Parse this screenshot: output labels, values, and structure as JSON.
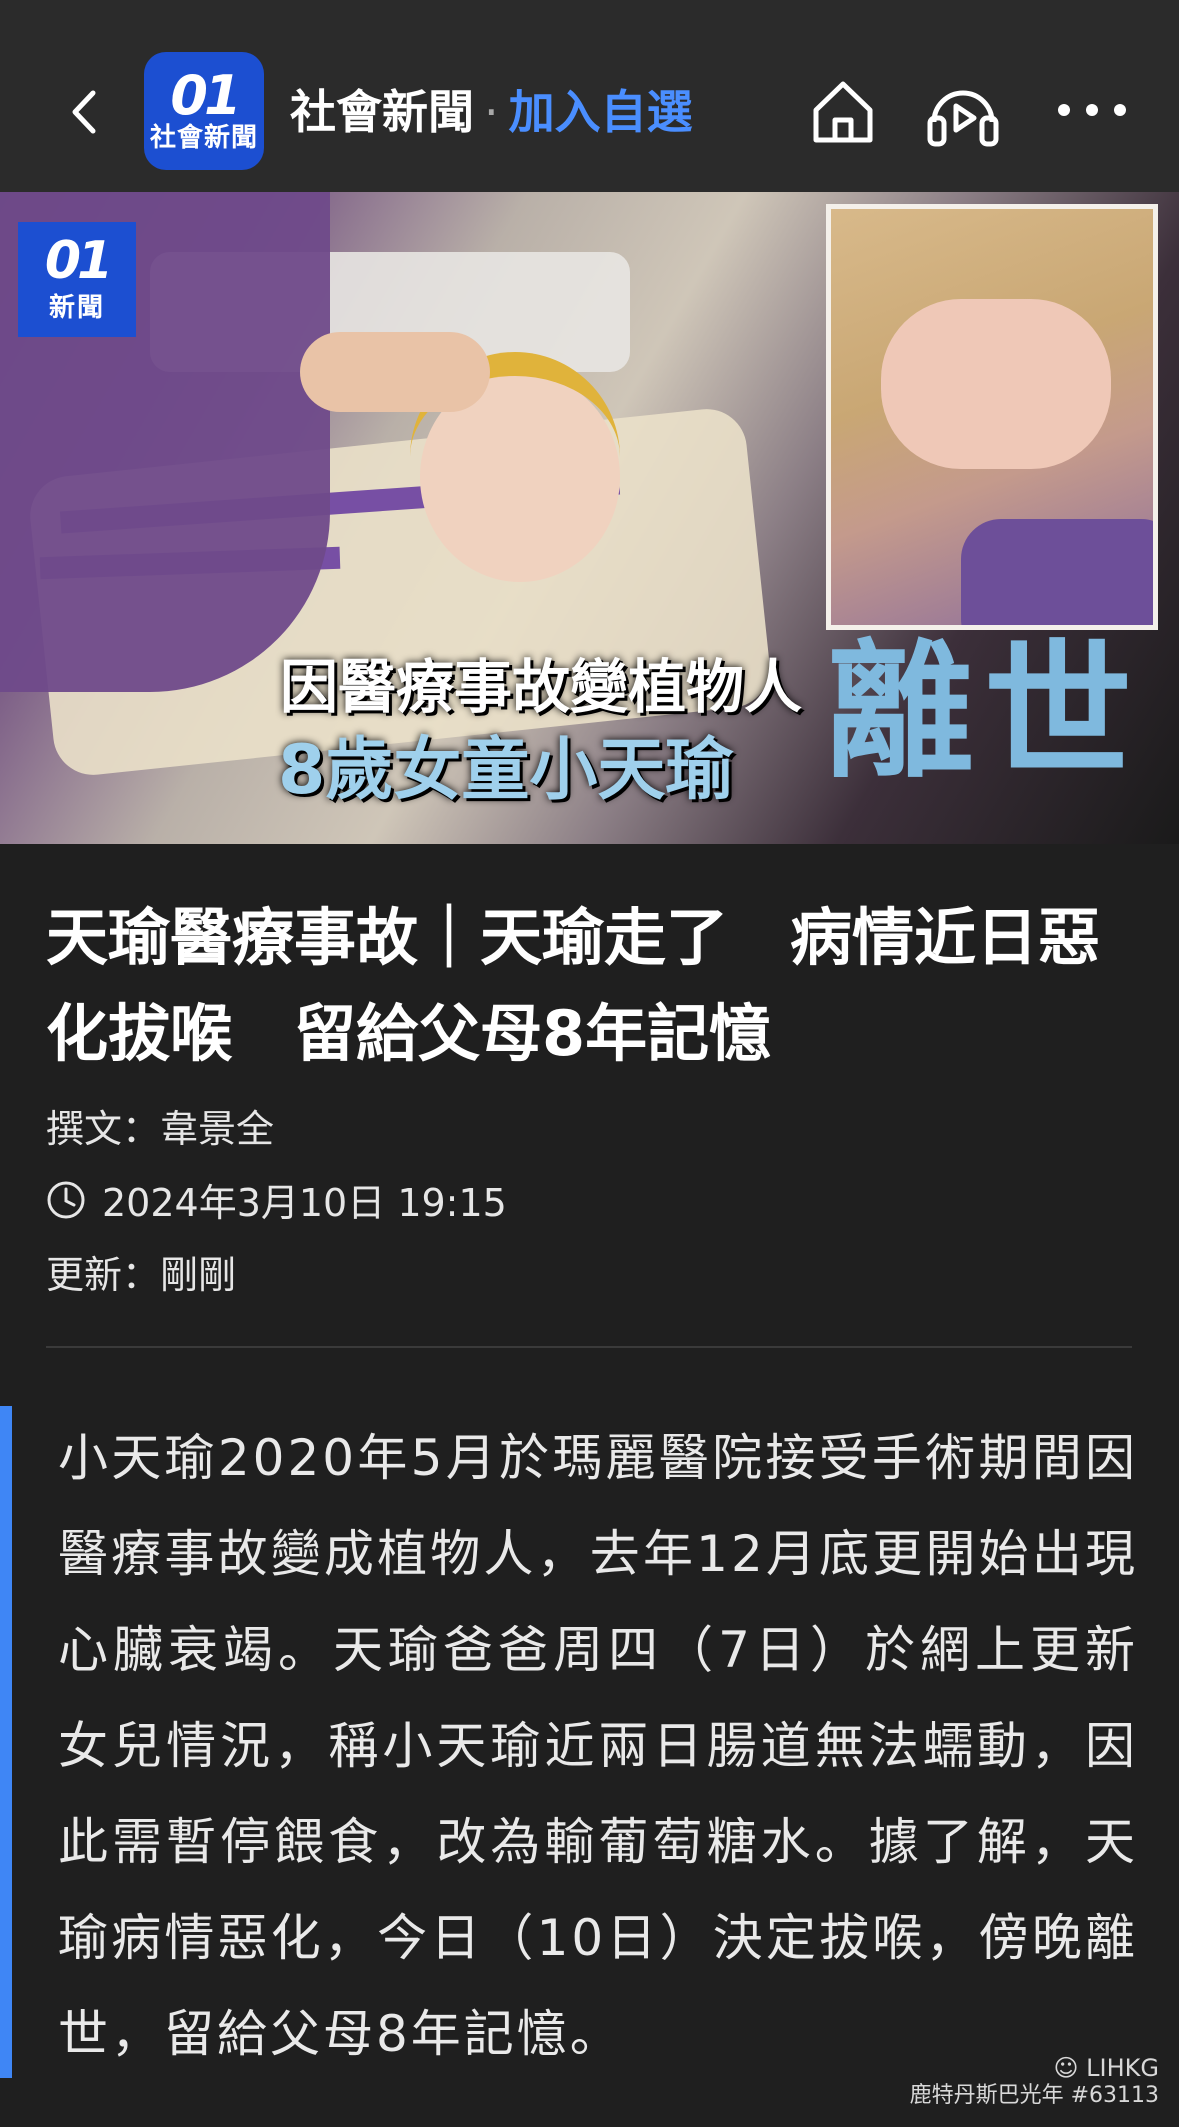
{
  "topbar": {
    "logo_num": "01",
    "logo_text": "社會新聞",
    "channel_name": "社會新聞",
    "separator": "·",
    "follow_label": "加入自選",
    "icons": [
      "back-icon",
      "home-icon",
      "audio-play-icon",
      "more-icon"
    ],
    "accent_color": "#4a8eff",
    "logo_color": "#1c4fd1"
  },
  "hero": {
    "badge_num": "01",
    "badge_text": "新聞",
    "caption_line1": "因醫療事故變植物人",
    "caption_line2": "8歲女童小天瑜",
    "caption_big": "離世"
  },
  "article": {
    "headline": "天瑜醫療事故｜天瑜走了　病情近日惡化拔喉　留給父母8年記憶",
    "author": "撰文：韋景全",
    "published": "2024年3月10日 19:15",
    "updated": "更新：剛剛",
    "body": "小天瑜2020年5月於瑪麗醫院接受手術期間因醫療事故變成植物人，去年12月底更開始出現心臟衰竭。天瑜爸爸周四（7日）於網上更新女兒情況，稱小天瑜近兩日腸道無法蠕動，因此需暫停餵食，改為輸葡萄糖水。據了解，天瑜病情惡化，今日（10日）決定拔喉，傍晚離世，留給父母8年記憶。"
  },
  "watermark": {
    "line1": "LIHKG",
    "line2": "鹿特丹斯巴光年 #63113"
  }
}
